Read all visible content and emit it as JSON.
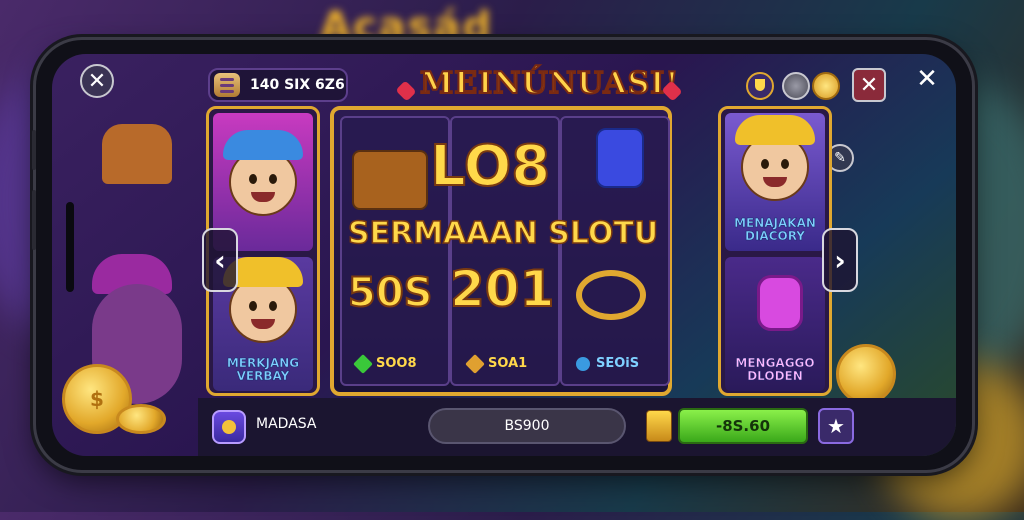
{
  "background": {
    "blurred_title": "Acasád"
  },
  "window": {
    "close_left_icon": "close-icon",
    "close_right_icon": "close-icon"
  },
  "topbar": {
    "coins": "140 SIX 6Z6",
    "menu_icon": "menu-icon",
    "title": "MEINÚNUASI!",
    "icons": [
      "trophy-icon",
      "gear-icon",
      "coin-icon"
    ],
    "edit_icon": "pencil-icon"
  },
  "reels": {
    "left_column": [
      {
        "character": "character-top",
        "label": ""
      },
      {
        "character": "character-bottom",
        "label": "MERKJANG VERBAY"
      }
    ],
    "center": {
      "big_word": "LO8",
      "subtitle": "SERMAAAN SLOTU",
      "left_number": "50S",
      "right_number": "201",
      "prizes": [
        {
          "icon": "green-gem-icon",
          "label": "SOO8"
        },
        {
          "icon": "gold-bar-icon",
          "label": "SOA1"
        },
        {
          "icon": "blue-gem-icon",
          "label": "SEOiS"
        }
      ]
    },
    "right_column": [
      {
        "character": "character-right-top",
        "label": "MENAJAKAN DIACORY"
      },
      {
        "character": "character-right-bottom",
        "label": "MENGAGGO DLODEN"
      }
    ],
    "nav_left": "‹",
    "nav_right": "›"
  },
  "bottombar": {
    "player_name": "MADASA",
    "balance": "BS900",
    "bet_value": "-8S.60",
    "star_label": "★"
  },
  "colors": {
    "accent_gold": "#e0a830",
    "panel_purple": "#2a1846",
    "bet_green": "#5ac82a"
  }
}
